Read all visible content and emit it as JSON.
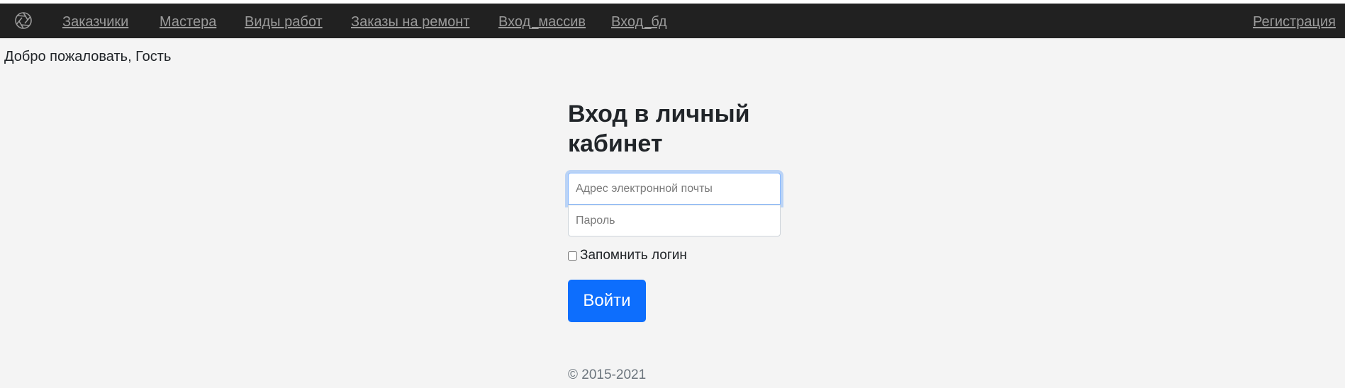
{
  "nav": {
    "links": [
      "Заказчики",
      "Мастера",
      "Виды работ",
      "Заказы на ремонт",
      "Вход_массив",
      "Вход_бд"
    ],
    "register": "Регистрация",
    "logo_icon": "aperture-icon"
  },
  "welcome": "Добро пожаловать, Гость",
  "login": {
    "title": "Вход в личный кабинет",
    "email_placeholder": "Адрес электронной почты",
    "password_placeholder": "Пароль",
    "remember_label": "Запомнить логин",
    "remember_checked": false,
    "submit_label": "Войти"
  },
  "footer": {
    "copyright": "© 2015-2021"
  },
  "colors": {
    "navbar": "#212121",
    "link": "#9a9a9a",
    "primary": "#0d6efd",
    "background": "#f4f4f4"
  }
}
